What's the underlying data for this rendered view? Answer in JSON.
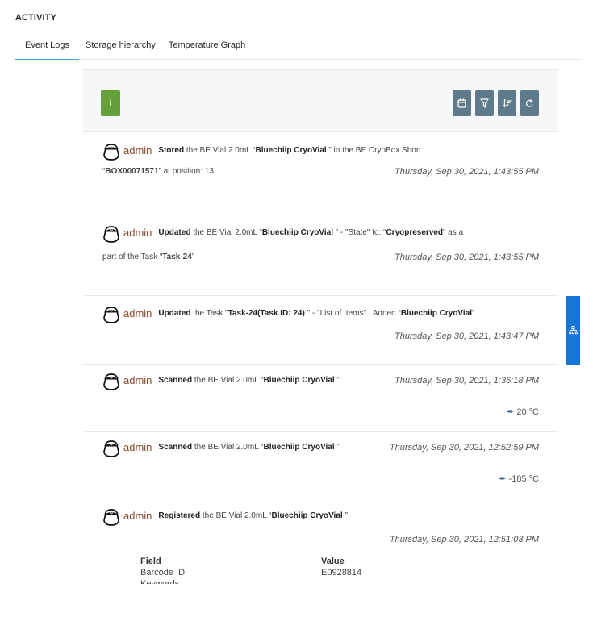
{
  "section_title": "ACTIVITY",
  "tabs": [
    {
      "label": "Event Logs",
      "active": true
    },
    {
      "label": "Storage hierarchy",
      "active": false
    },
    {
      "label": "Temperature Graph",
      "active": false
    }
  ],
  "toolbar": {
    "info_label": "i",
    "info_color": "#66a03a",
    "tool_color": "#5e7a8b",
    "buttons": [
      {
        "icon": "calendar-icon"
      },
      {
        "icon": "filter-icon"
      },
      {
        "icon": "sort-icon"
      },
      {
        "icon": "refresh-icon"
      }
    ]
  },
  "events": [
    {
      "user": "admin",
      "action": "Stored",
      "text1": " the BE Vial 2.0mL “",
      "bold1": "Bluechiip CryoVial",
      "text2": " ” in the BE CryoBox Short",
      "line2_pre": "“",
      "line2_bold": "BOX00071571",
      "line2_post": "” at position: 13",
      "timestamp": "Thursday, Sep 30, 2021, 1:43:55 PM"
    },
    {
      "user": "admin",
      "action": "Updated",
      "text1": " the BE Vial 2.0mL “",
      "bold1": "Bluechiip CryoVial",
      "text2": " ” - \"State\" to: “",
      "bold2": "Cryopreserved",
      "text3": "” as a",
      "line2_pre": "part of the Task “",
      "line2_bold": "Task-24",
      "line2_post": "”",
      "timestamp": "Thursday, Sep 30, 2021, 1:43:55 PM"
    },
    {
      "user": "admin",
      "action": "Updated",
      "text1": " the Task \"",
      "bold1": "Task-24(Task ID: 24)",
      "text2": " \" - \"List of Items\" : Added “",
      "bold2": "Bluechiip CryoVial",
      "text3": "”",
      "timestamp": "Thursday, Sep 30, 2021, 1:43:47 PM",
      "side_tab_icon": "hierarchy-icon",
      "side_tab_color": "#1476d6"
    },
    {
      "user": "admin",
      "action": "Scanned",
      "text1": " the BE Vial 2.0mL “",
      "bold1": "Bluechiip CryoVial",
      "text2": " ”",
      "timestamp": "Thursday, Sep 30, 2021, 1:36:18 PM",
      "temperature": "20 °C"
    },
    {
      "user": "admin",
      "action": "Scanned",
      "text1": " the BE Vial 2.0mL “",
      "bold1": "Bluechiip CryoVial",
      "text2": " ”",
      "timestamp": "Thursday, Sep 30, 2021, 12:52:59 PM",
      "temperature": "-185 °C"
    },
    {
      "user": "admin",
      "action": "Registered",
      "text1": " the BE Vial 2.0mL “",
      "bold1": "Bluechiip CryoVial",
      "text2": " ”",
      "timestamp": "Thursday, Sep 30, 2021, 12:51:03 PM",
      "fields_header": {
        "field": "Field",
        "value": "Value"
      },
      "fields": [
        {
          "field": "Barcode ID",
          "value": "E0928814"
        },
        {
          "field": "Keywords",
          "value": ""
        }
      ]
    }
  ]
}
